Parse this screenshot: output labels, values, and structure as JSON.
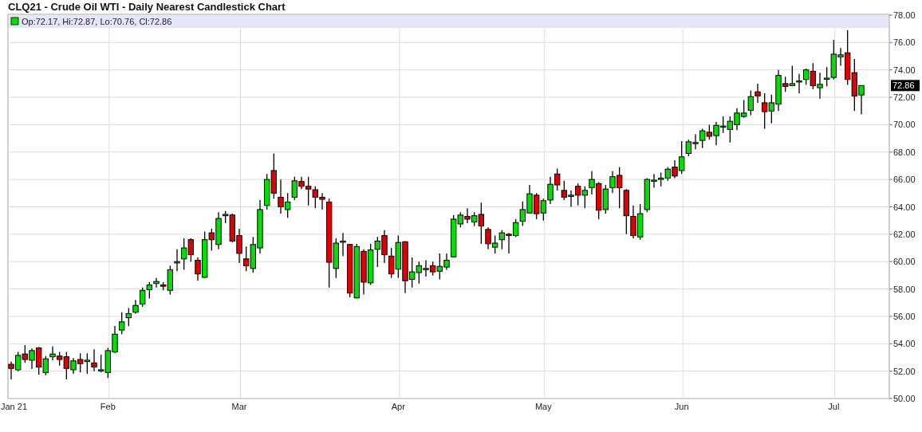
{
  "title": "CLQ21 - Crude Oil WTI - Daily Nearest Candlestick Chart",
  "legend": {
    "text": "Op:72.17, Hi:72.87, Lo:70.76, Cl:72.86"
  },
  "last_price": "72.86",
  "chart_data": {
    "type": "candlestick",
    "ylim": [
      50,
      78
    ],
    "grid": true,
    "yticks": [
      {
        "value": 50,
        "label": "50.00"
      },
      {
        "value": 52,
        "label": "52.00"
      },
      {
        "value": 54,
        "label": "54.00"
      },
      {
        "value": 56,
        "label": "56.00"
      },
      {
        "value": 58,
        "label": "58.00"
      },
      {
        "value": 60,
        "label": "60.00"
      },
      {
        "value": 62,
        "label": "62.00"
      },
      {
        "value": 64,
        "label": "64.00"
      },
      {
        "value": 66,
        "label": "66.00"
      },
      {
        "value": 68,
        "label": "68.00"
      },
      {
        "value": 70,
        "label": "70.00"
      },
      {
        "value": 72,
        "label": "72.00"
      },
      {
        "value": 74,
        "label": "74.00"
      },
      {
        "value": 76,
        "label": "76.00"
      },
      {
        "value": 78,
        "label": "78.00"
      }
    ],
    "categories": [
      "Jan 21",
      null,
      null,
      null,
      null,
      null,
      null,
      null,
      null,
      null,
      null,
      null,
      null,
      null,
      "Feb",
      null,
      null,
      null,
      null,
      null,
      null,
      null,
      null,
      null,
      null,
      null,
      null,
      null,
      null,
      null,
      null,
      null,
      null,
      "Mar",
      null,
      null,
      null,
      null,
      null,
      null,
      null,
      null,
      null,
      null,
      null,
      null,
      null,
      null,
      null,
      null,
      null,
      null,
      null,
      null,
      null,
      null,
      "Apr",
      null,
      null,
      null,
      null,
      null,
      null,
      null,
      null,
      null,
      null,
      null,
      null,
      null,
      null,
      null,
      null,
      null,
      null,
      null,
      null,
      "May",
      null,
      null,
      null,
      null,
      null,
      null,
      null,
      null,
      null,
      null,
      null,
      null,
      null,
      null,
      null,
      null,
      null,
      null,
      null,
      "Jun",
      null,
      null,
      null,
      null,
      null,
      null,
      null,
      null,
      null,
      null,
      null,
      null,
      null,
      null,
      null,
      null,
      null,
      null,
      null,
      null,
      null,
      "Jul",
      null,
      null,
      null,
      null
    ],
    "ohlc": [
      [
        52.5,
        52.7,
        51.4,
        52.2
      ],
      [
        52.1,
        53.4,
        52.0,
        53.15
      ],
      [
        53.25,
        53.9,
        52.6,
        52.85
      ],
      [
        52.8,
        53.65,
        52.15,
        53.5
      ],
      [
        53.7,
        53.75,
        51.75,
        52.3
      ],
      [
        51.9,
        53.1,
        51.7,
        52.9
      ],
      [
        53.05,
        53.8,
        52.8,
        53.25
      ],
      [
        53.1,
        53.4,
        52.4,
        52.85
      ],
      [
        53.05,
        53.4,
        51.4,
        52.2
      ],
      [
        52.1,
        52.95,
        51.8,
        52.75
      ],
      [
        52.85,
        53.3,
        51.9,
        52.55
      ],
      [
        52.7,
        53.3,
        51.8,
        52.8
      ],
      [
        52.6,
        53.6,
        52.0,
        52.3
      ],
      [
        52.1,
        53.2,
        51.9,
        52.1
      ],
      [
        51.9,
        53.7,
        51.5,
        53.5
      ],
      [
        53.4,
        55.3,
        53.3,
        54.7
      ],
      [
        55.0,
        56.3,
        54.7,
        55.6
      ],
      [
        55.9,
        56.6,
        55.3,
        56.2
      ],
      [
        56.3,
        57.2,
        56.2,
        56.8
      ],
      [
        56.9,
        58.1,
        56.7,
        57.9
      ],
      [
        57.95,
        58.5,
        57.3,
        58.3
      ],
      [
        58.4,
        58.8,
        58.1,
        58.55
      ],
      [
        58.3,
        58.5,
        57.9,
        58.2
      ],
      [
        57.9,
        59.7,
        57.6,
        59.4
      ],
      [
        59.9,
        60.9,
        59.3,
        60.0
      ],
      [
        60.2,
        61.7,
        59.4,
        61.0
      ],
      [
        61.6,
        61.7,
        60.0,
        60.5
      ],
      [
        60.1,
        60.3,
        58.6,
        59.1
      ],
      [
        58.85,
        62.2,
        58.8,
        61.6
      ],
      [
        62.1,
        62.4,
        60.8,
        61.6
      ],
      [
        61.25,
        63.6,
        60.9,
        63.15
      ],
      [
        63.35,
        63.7,
        62.8,
        63.45
      ],
      [
        63.4,
        63.5,
        61.4,
        61.5
      ],
      [
        61.9,
        62.4,
        59.9,
        60.6
      ],
      [
        60.2,
        61.1,
        59.3,
        59.7
      ],
      [
        59.5,
        61.8,
        59.2,
        61.25
      ],
      [
        61.0,
        64.5,
        60.6,
        63.8
      ],
      [
        64.1,
        66.4,
        63.8,
        66.0
      ],
      [
        66.65,
        67.9,
        64.6,
        65.0
      ],
      [
        64.7,
        66.0,
        63.5,
        64.0
      ],
      [
        63.8,
        65.0,
        63.2,
        64.35
      ],
      [
        64.7,
        66.2,
        64.5,
        65.9
      ],
      [
        65.85,
        66.2,
        65.3,
        65.5
      ],
      [
        65.5,
        66.2,
        64.1,
        65.3
      ],
      [
        65.25,
        65.5,
        63.9,
        64.7
      ],
      [
        64.7,
        65.0,
        63.8,
        64.55
      ],
      [
        64.35,
        64.6,
        58.1,
        59.95
      ],
      [
        59.5,
        61.7,
        58.8,
        61.35
      ],
      [
        61.5,
        62.1,
        60.4,
        61.5
      ],
      [
        61.25,
        61.3,
        57.4,
        57.7
      ],
      [
        57.35,
        61.3,
        57.3,
        61.1
      ],
      [
        60.75,
        60.9,
        57.6,
        58.5
      ],
      [
        58.45,
        61.3,
        58.3,
        60.85
      ],
      [
        60.9,
        61.8,
        59.6,
        61.5
      ],
      [
        61.9,
        62.3,
        59.9,
        60.5
      ],
      [
        60.4,
        61.0,
        58.8,
        59.1
      ],
      [
        59.45,
        61.9,
        58.8,
        61.4
      ],
      [
        61.45,
        61.5,
        57.7,
        58.6
      ],
      [
        58.7,
        60.3,
        58.1,
        59.25
      ],
      [
        59.2,
        60.0,
        58.4,
        59.7
      ],
      [
        59.5,
        60.1,
        58.9,
        59.5
      ],
      [
        59.7,
        60.0,
        59.0,
        59.25
      ],
      [
        59.3,
        60.6,
        58.7,
        59.65
      ],
      [
        59.6,
        60.6,
        59.4,
        60.1
      ],
      [
        60.35,
        63.4,
        60.3,
        63.1
      ],
      [
        62.75,
        63.6,
        62.5,
        63.4
      ],
      [
        63.3,
        63.9,
        62.8,
        63.1
      ],
      [
        62.9,
        63.6,
        62.6,
        63.35
      ],
      [
        63.45,
        64.3,
        61.3,
        62.6
      ],
      [
        62.35,
        62.5,
        60.9,
        61.3
      ],
      [
        61.05,
        61.9,
        60.6,
        61.35
      ],
      [
        61.6,
        62.3,
        60.9,
        62.1
      ],
      [
        62.0,
        62.1,
        60.6,
        61.9
      ],
      [
        61.9,
        63.1,
        61.8,
        62.85
      ],
      [
        62.95,
        64.4,
        62.6,
        63.8
      ],
      [
        63.55,
        65.6,
        63.5,
        64.95
      ],
      [
        64.85,
        65.0,
        63.1,
        63.5
      ],
      [
        63.55,
        64.6,
        63.0,
        64.45
      ],
      [
        64.5,
        66.2,
        64.2,
        65.65
      ],
      [
        66.4,
        66.8,
        65.2,
        65.6
      ],
      [
        65.2,
        65.9,
        64.5,
        64.7
      ],
      [
        64.85,
        65.2,
        64.0,
        64.85
      ],
      [
        65.5,
        65.7,
        64.1,
        64.85
      ],
      [
        64.85,
        65.5,
        63.9,
        65.2
      ],
      [
        65.4,
        66.6,
        64.9,
        66.0
      ],
      [
        65.7,
        65.8,
        63.1,
        63.75
      ],
      [
        63.8,
        65.6,
        63.5,
        65.3
      ],
      [
        65.4,
        66.6,
        65.0,
        66.2
      ],
      [
        66.3,
        66.9,
        63.9,
        65.4
      ],
      [
        65.2,
        65.3,
        62.0,
        63.35
      ],
      [
        63.3,
        64.1,
        61.7,
        61.9
      ],
      [
        61.8,
        64.2,
        61.6,
        63.5
      ],
      [
        63.8,
        66.1,
        63.6,
        66.0
      ],
      [
        65.95,
        66.4,
        65.4,
        65.95
      ],
      [
        66.0,
        66.5,
        65.5,
        66.1
      ],
      [
        66.1,
        66.9,
        65.9,
        66.75
      ],
      [
        66.9,
        67.4,
        66.1,
        66.25
      ],
      [
        66.65,
        68.8,
        66.4,
        67.65
      ],
      [
        67.9,
        68.9,
        67.7,
        68.75
      ],
      [
        68.7,
        69.3,
        68.2,
        68.7
      ],
      [
        68.85,
        69.7,
        68.3,
        69.55
      ],
      [
        69.45,
        70.0,
        68.9,
        69.15
      ],
      [
        69.2,
        70.2,
        68.5,
        69.95
      ],
      [
        69.9,
        70.6,
        69.4,
        69.9
      ],
      [
        69.65,
        70.6,
        68.7,
        70.25
      ],
      [
        70.0,
        71.2,
        69.6,
        70.85
      ],
      [
        70.6,
        71.8,
        70.5,
        70.85
      ],
      [
        71.05,
        72.5,
        70.7,
        72.05
      ],
      [
        72.4,
        73.0,
        71.6,
        72.1
      ],
      [
        71.6,
        72.3,
        69.7,
        70.95
      ],
      [
        71.0,
        72.2,
        70.1,
        71.6
      ],
      [
        71.5,
        74.0,
        71.0,
        73.6
      ],
      [
        73.0,
        73.5,
        72.4,
        72.8
      ],
      [
        72.85,
        74.3,
        72.8,
        73.0
      ],
      [
        73.2,
        73.7,
        72.3,
        73.2
      ],
      [
        73.3,
        74.1,
        72.9,
        74.0
      ],
      [
        73.9,
        74.5,
        72.6,
        72.85
      ],
      [
        72.7,
        73.8,
        71.9,
        72.95
      ],
      [
        73.4,
        74.2,
        72.8,
        73.4
      ],
      [
        73.45,
        76.2,
        73.3,
        75.15
      ],
      [
        74.95,
        75.6,
        74.3,
        75.1
      ],
      [
        75.25,
        76.9,
        72.9,
        73.3
      ],
      [
        73.8,
        74.8,
        71.0,
        72.1
      ],
      [
        72.17,
        72.87,
        70.76,
        72.86
      ]
    ]
  }
}
